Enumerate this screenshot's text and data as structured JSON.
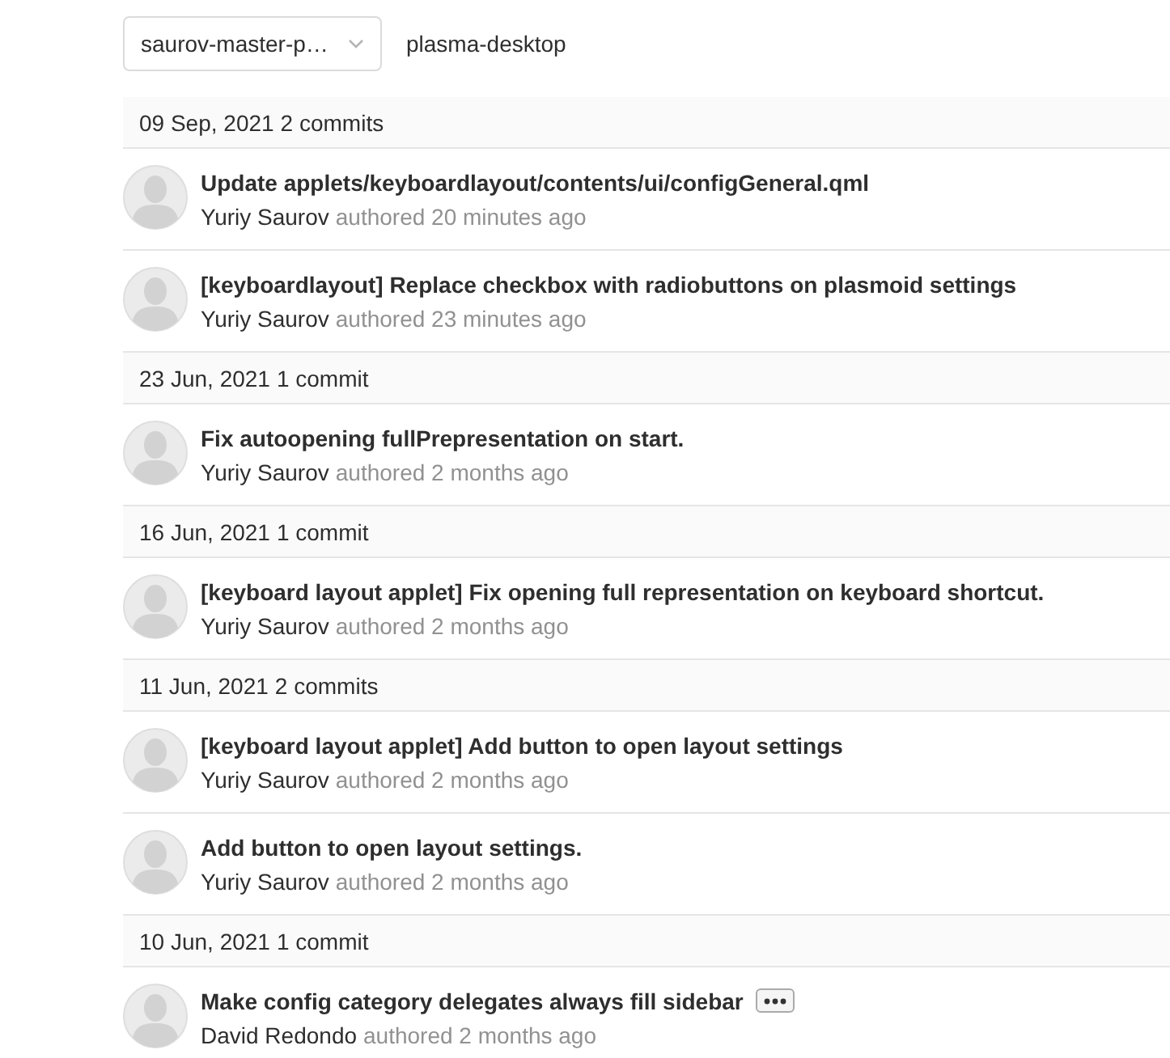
{
  "branch_selector": {
    "value": "saurov-master-p…"
  },
  "project": "plasma-desktop",
  "days": [
    {
      "date": "09 Sep, 2021",
      "count": "2 commits",
      "commits": [
        {
          "title": "Update applets/keyboardlayout/contents/ui/configGeneral.qml",
          "author": "Yuriy Saurov",
          "meta": "authored 20 minutes ago",
          "has_description": false
        },
        {
          "title": "[keyboardlayout] Replace checkbox with radiobuttons on plasmoid settings",
          "author": "Yuriy Saurov",
          "meta": "authored 23 minutes ago",
          "has_description": false
        }
      ]
    },
    {
      "date": "23 Jun, 2021",
      "count": "1 commit",
      "commits": [
        {
          "title": "Fix autoopening fullPrepresentation on start.",
          "author": "Yuriy Saurov",
          "meta": "authored 2 months ago",
          "has_description": false
        }
      ]
    },
    {
      "date": "16 Jun, 2021",
      "count": "1 commit",
      "commits": [
        {
          "title": "[keyboard layout applet] Fix opening full representation on keyboard shortcut.",
          "author": "Yuriy Saurov",
          "meta": "authored 2 months ago",
          "has_description": false
        }
      ]
    },
    {
      "date": "11 Jun, 2021",
      "count": "2 commits",
      "commits": [
        {
          "title": "[keyboard layout applet] Add button to open layout settings",
          "author": "Yuriy Saurov",
          "meta": "authored 2 months ago",
          "has_description": false
        },
        {
          "title": "Add button to open layout settings.",
          "author": "Yuriy Saurov",
          "meta": "authored 2 months ago",
          "has_description": false
        }
      ]
    },
    {
      "date": "10 Jun, 2021",
      "count": "1 commit",
      "commits": [
        {
          "title": "Make config category delegates always fill sidebar",
          "author": "David Redondo",
          "meta": "authored 2 months ago",
          "has_description": true
        }
      ]
    }
  ]
}
